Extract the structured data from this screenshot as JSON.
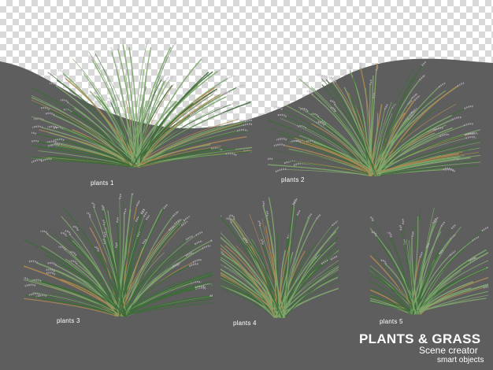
{
  "colors": {
    "background": "#5e5e5e",
    "grass_light": "#7fa86e",
    "grass_dark": "#3e6a3a",
    "plume": "#bdb6c0",
    "dry": "#b08a52"
  },
  "labels": {
    "plant1": "plants 1",
    "plant2": "plants 2",
    "plant3": "plants 3",
    "plant4": "plants 4",
    "plant5": "plants 5"
  },
  "branding": {
    "title": "PLANTS & GRASS",
    "subtitle": "Scene creator",
    "subsubtitle": "smart objects"
  }
}
